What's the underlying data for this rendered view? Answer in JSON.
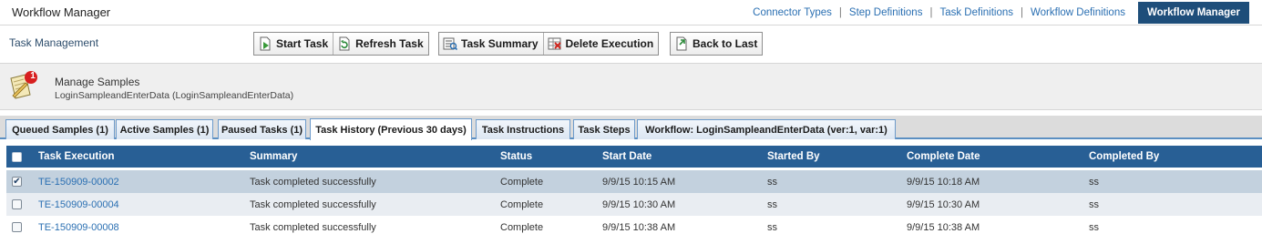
{
  "app_title": "Workflow Manager",
  "top_nav": {
    "links": [
      "Connector Types",
      "Step Definitions",
      "Task Definitions",
      "Workflow Definitions"
    ],
    "separator": "|",
    "active": "Workflow Manager"
  },
  "toolbar": {
    "section_title": "Task Management",
    "start_task": "Start Task",
    "refresh_task": "Refresh Task",
    "task_summary": "Task Summary",
    "delete_execution": "Delete Execution",
    "back_to_last": "Back to Last"
  },
  "info": {
    "name": "Manage Samples",
    "subtitle": "LoginSampleandEnterData (LoginSampleandEnterData)",
    "badge": "1"
  },
  "tabs": [
    "Queued Samples (1)",
    "Active Samples (1)",
    "Paused Tasks (1)",
    "Task History (Previous 30 days)",
    "Task Instructions",
    "Task Steps",
    "Workflow: LoginSampleandEnterData (ver:1, var:1)"
  ],
  "active_tab": "Task History (Previous 30 days)",
  "grid": {
    "columns": [
      "Task Execution",
      "Summary",
      "Status",
      "Start Date",
      "Started By",
      "Complete Date",
      "Completed By"
    ],
    "rows": [
      {
        "checked": true,
        "task_execution": "TE-150909-00002",
        "summary": "Task completed successfully",
        "status": "Complete",
        "start_date": "9/9/15 10:15 AM",
        "started_by": "ss",
        "complete_date": "9/9/15 10:18 AM",
        "completed_by": "ss"
      },
      {
        "checked": false,
        "task_execution": "TE-150909-00004",
        "summary": "Task completed successfully",
        "status": "Complete",
        "start_date": "9/9/15 10:30 AM",
        "started_by": "ss",
        "complete_date": "9/9/15 10:30 AM",
        "completed_by": "ss"
      },
      {
        "checked": false,
        "task_execution": "TE-150909-00008",
        "summary": "Task completed successfully",
        "status": "Complete",
        "start_date": "9/9/15 10:38 AM",
        "started_by": "ss",
        "complete_date": "9/9/15 10:38 AM",
        "completed_by": "ss"
      }
    ]
  },
  "colors": {
    "header_bg": "#285f95",
    "active_nav_bg": "#1e4e7a",
    "link": "#2a6fb2",
    "selected_row": "#c3d1de",
    "alt_row": "#e9edf2"
  }
}
